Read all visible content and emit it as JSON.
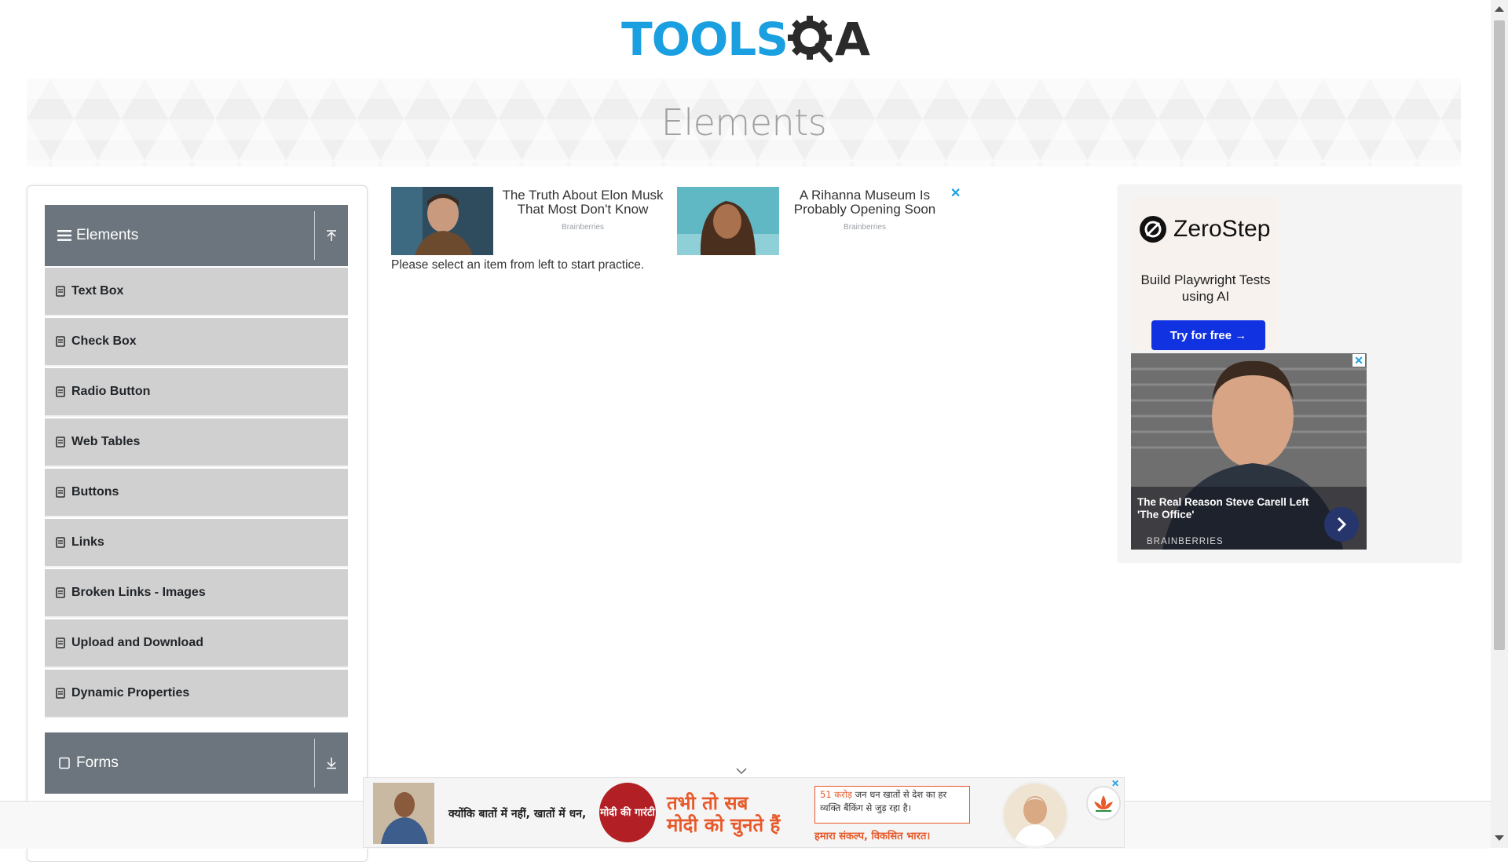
{
  "header": {
    "logo_left": "TOOLS",
    "logo_right": "A"
  },
  "banner": {
    "title": "Elements"
  },
  "sidebar": {
    "group_elements": "Elements",
    "items": [
      {
        "label": "Text Box"
      },
      {
        "label": "Check Box"
      },
      {
        "label": "Radio Button"
      },
      {
        "label": "Web Tables"
      },
      {
        "label": "Buttons"
      },
      {
        "label": "Links"
      },
      {
        "label": "Broken Links - Images"
      },
      {
        "label": "Upload and Download"
      },
      {
        "label": "Dynamic Properties"
      }
    ],
    "group_forms": "Forms"
  },
  "content": {
    "ads": [
      {
        "title": "The Truth About Elon Musk That Most Don't Know",
        "source": "Brainberries"
      },
      {
        "title": "A Rihanna Museum Is Probably Opening Soon",
        "source": "Brainberries"
      }
    ],
    "ad_close": "✕",
    "message": "Please select an item from left to start practice."
  },
  "right_ad": {
    "brand": "ZeroStep",
    "tagline": "Build Playwright Tests using AI",
    "cta": "Try for free →",
    "office_caption": "The Real Reason Steve Carell Left 'The Office'",
    "office_source": "BRAINBERRIES",
    "office_close": "✕"
  },
  "bottom_ad": {
    "text1": "क्योंकि बातों में नहीं, खातों में धन,",
    "seal": "मोदी की गारंटी",
    "slogan_line1": "तभी तो सब",
    "slogan_line2": "मोदी को चुनते हैं",
    "box_highlight": "51 करोड़",
    "box_text": "जन धन खातों से देश का हर व्यक्ति बैंकिंग से जुड़ रहा है।",
    "footer": "हमारा संकल्प, विकसित भारत।",
    "close": "✕"
  },
  "colors": {
    "brand_blue": "#1a9fe0",
    "sidebar_header": "#6c757d",
    "sidebar_item": "#d0d0d0",
    "zerostep_button": "#1132e0"
  }
}
